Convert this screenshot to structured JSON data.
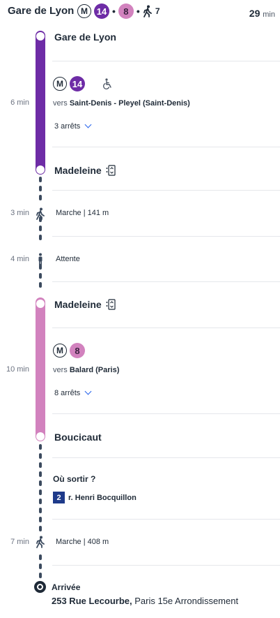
{
  "header": {
    "title": "Gare de Lyon",
    "metro_symbol": "M",
    "line1": "14",
    "line2": "8",
    "walk_count": "7",
    "duration": "29",
    "duration_unit": "min"
  },
  "segments": {
    "seg1": {
      "start_stop": "Gare de Lyon",
      "time": "6 min",
      "metro_symbol": "M",
      "line": "14",
      "direction_prefix": "vers ",
      "direction": "Saint-Denis - Pleyel (Saint-Denis)",
      "stops": "3 arrêts",
      "end_stop": "Madeleine"
    },
    "walk1": {
      "time": "3 min",
      "label": "Marche | 141 m"
    },
    "wait": {
      "time": "4 min",
      "label": "Attente"
    },
    "seg2": {
      "start_stop": "Madeleine",
      "time": "10 min",
      "metro_symbol": "M",
      "line": "8",
      "direction_prefix": "vers ",
      "direction": "Balard (Paris)",
      "stops": "8 arrêts",
      "end_stop": "Boucicaut"
    },
    "exit": {
      "title": "Où sortir ?",
      "number": "2",
      "street": "r. Henri Bocquillon"
    },
    "walk2": {
      "time": "7 min",
      "label": "Marche | 408 m"
    },
    "arrival": {
      "label": "Arrivée",
      "address_bold": "253 Rue Lecourbe,",
      "address_rest": " Paris 15e Arrondissement"
    }
  },
  "colors": {
    "line14": "#6e2ca6",
    "line8": "#d282be",
    "line8_text": "#3b2140",
    "walk_dash": "#3b4a5e",
    "accent": "#2563eb"
  },
  "icons": [
    "metro-icon",
    "walk-icon",
    "wheelchair-icon",
    "wait-person-icon",
    "elevator-icon",
    "chevron-down-icon",
    "destination-icon"
  ]
}
